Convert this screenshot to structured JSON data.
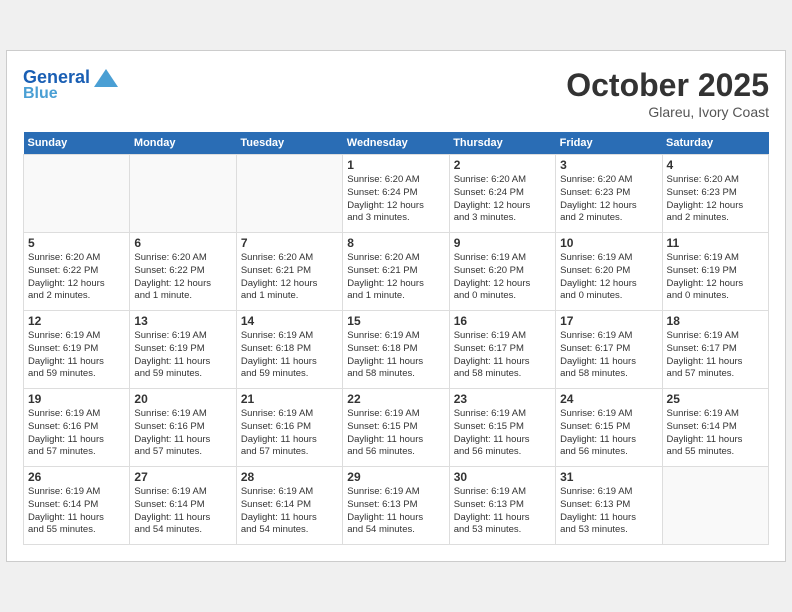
{
  "header": {
    "logo_line1": "General",
    "logo_line2": "Blue",
    "month_title": "October 2025",
    "location": "Glareu, Ivory Coast"
  },
  "weekdays": [
    "Sunday",
    "Monday",
    "Tuesday",
    "Wednesday",
    "Thursday",
    "Friday",
    "Saturday"
  ],
  "weeks": [
    [
      {
        "day": "",
        "info": ""
      },
      {
        "day": "",
        "info": ""
      },
      {
        "day": "",
        "info": ""
      },
      {
        "day": "1",
        "info": "Sunrise: 6:20 AM\nSunset: 6:24 PM\nDaylight: 12 hours\nand 3 minutes."
      },
      {
        "day": "2",
        "info": "Sunrise: 6:20 AM\nSunset: 6:24 PM\nDaylight: 12 hours\nand 3 minutes."
      },
      {
        "day": "3",
        "info": "Sunrise: 6:20 AM\nSunset: 6:23 PM\nDaylight: 12 hours\nand 2 minutes."
      },
      {
        "day": "4",
        "info": "Sunrise: 6:20 AM\nSunset: 6:23 PM\nDaylight: 12 hours\nand 2 minutes."
      }
    ],
    [
      {
        "day": "5",
        "info": "Sunrise: 6:20 AM\nSunset: 6:22 PM\nDaylight: 12 hours\nand 2 minutes."
      },
      {
        "day": "6",
        "info": "Sunrise: 6:20 AM\nSunset: 6:22 PM\nDaylight: 12 hours\nand 1 minute."
      },
      {
        "day": "7",
        "info": "Sunrise: 6:20 AM\nSunset: 6:21 PM\nDaylight: 12 hours\nand 1 minute."
      },
      {
        "day": "8",
        "info": "Sunrise: 6:20 AM\nSunset: 6:21 PM\nDaylight: 12 hours\nand 1 minute."
      },
      {
        "day": "9",
        "info": "Sunrise: 6:19 AM\nSunset: 6:20 PM\nDaylight: 12 hours\nand 0 minutes."
      },
      {
        "day": "10",
        "info": "Sunrise: 6:19 AM\nSunset: 6:20 PM\nDaylight: 12 hours\nand 0 minutes."
      },
      {
        "day": "11",
        "info": "Sunrise: 6:19 AM\nSunset: 6:19 PM\nDaylight: 12 hours\nand 0 minutes."
      }
    ],
    [
      {
        "day": "12",
        "info": "Sunrise: 6:19 AM\nSunset: 6:19 PM\nDaylight: 11 hours\nand 59 minutes."
      },
      {
        "day": "13",
        "info": "Sunrise: 6:19 AM\nSunset: 6:19 PM\nDaylight: 11 hours\nand 59 minutes."
      },
      {
        "day": "14",
        "info": "Sunrise: 6:19 AM\nSunset: 6:18 PM\nDaylight: 11 hours\nand 59 minutes."
      },
      {
        "day": "15",
        "info": "Sunrise: 6:19 AM\nSunset: 6:18 PM\nDaylight: 11 hours\nand 58 minutes."
      },
      {
        "day": "16",
        "info": "Sunrise: 6:19 AM\nSunset: 6:17 PM\nDaylight: 11 hours\nand 58 minutes."
      },
      {
        "day": "17",
        "info": "Sunrise: 6:19 AM\nSunset: 6:17 PM\nDaylight: 11 hours\nand 58 minutes."
      },
      {
        "day": "18",
        "info": "Sunrise: 6:19 AM\nSunset: 6:17 PM\nDaylight: 11 hours\nand 57 minutes."
      }
    ],
    [
      {
        "day": "19",
        "info": "Sunrise: 6:19 AM\nSunset: 6:16 PM\nDaylight: 11 hours\nand 57 minutes."
      },
      {
        "day": "20",
        "info": "Sunrise: 6:19 AM\nSunset: 6:16 PM\nDaylight: 11 hours\nand 57 minutes."
      },
      {
        "day": "21",
        "info": "Sunrise: 6:19 AM\nSunset: 6:16 PM\nDaylight: 11 hours\nand 57 minutes."
      },
      {
        "day": "22",
        "info": "Sunrise: 6:19 AM\nSunset: 6:15 PM\nDaylight: 11 hours\nand 56 minutes."
      },
      {
        "day": "23",
        "info": "Sunrise: 6:19 AM\nSunset: 6:15 PM\nDaylight: 11 hours\nand 56 minutes."
      },
      {
        "day": "24",
        "info": "Sunrise: 6:19 AM\nSunset: 6:15 PM\nDaylight: 11 hours\nand 56 minutes."
      },
      {
        "day": "25",
        "info": "Sunrise: 6:19 AM\nSunset: 6:14 PM\nDaylight: 11 hours\nand 55 minutes."
      }
    ],
    [
      {
        "day": "26",
        "info": "Sunrise: 6:19 AM\nSunset: 6:14 PM\nDaylight: 11 hours\nand 55 minutes."
      },
      {
        "day": "27",
        "info": "Sunrise: 6:19 AM\nSunset: 6:14 PM\nDaylight: 11 hours\nand 54 minutes."
      },
      {
        "day": "28",
        "info": "Sunrise: 6:19 AM\nSunset: 6:14 PM\nDaylight: 11 hours\nand 54 minutes."
      },
      {
        "day": "29",
        "info": "Sunrise: 6:19 AM\nSunset: 6:13 PM\nDaylight: 11 hours\nand 54 minutes."
      },
      {
        "day": "30",
        "info": "Sunrise: 6:19 AM\nSunset: 6:13 PM\nDaylight: 11 hours\nand 53 minutes."
      },
      {
        "day": "31",
        "info": "Sunrise: 6:19 AM\nSunset: 6:13 PM\nDaylight: 11 hours\nand 53 minutes."
      },
      {
        "day": "",
        "info": ""
      }
    ]
  ]
}
